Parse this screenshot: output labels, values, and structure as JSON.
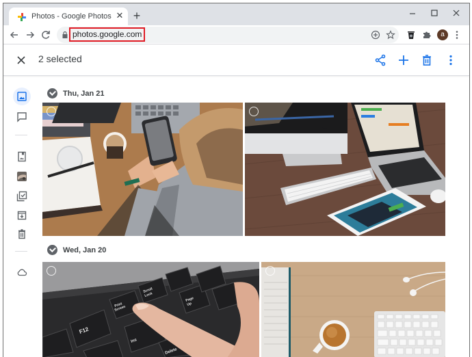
{
  "browser": {
    "tab": {
      "title": "Photos - Google Photos",
      "close_glyph": "✕",
      "favicon": "google-photos-pinwheel-icon"
    },
    "new_tab_glyph": "+",
    "window_controls": {
      "minimize": "–",
      "maximize": "☐",
      "close": "✕"
    },
    "nav": {
      "back": "←",
      "forward": "→",
      "reload": "C"
    },
    "address_bar": {
      "url": "photos.google.com",
      "highlighted": true,
      "highlight_color": "#e01b24"
    },
    "omnibox_icons": [
      "install-app-icon",
      "bookmark-star-icon"
    ],
    "toolbar_icons": [
      "trash-extension-icon",
      "extensions-puzzle-icon"
    ],
    "profile_avatar": {
      "letter": "a",
      "color": "#5d3a27"
    }
  },
  "app": {
    "selection_bar": {
      "close_glyph": "✕",
      "selected_text": "2 selected",
      "actions": [
        "share-icon",
        "add-icon",
        "delete-icon",
        "more-options-icon"
      ],
      "accent_color": "#1a73e8"
    },
    "sidebar": {
      "items": [
        {
          "name": "photos",
          "icon": "photo-icon",
          "active": true
        },
        {
          "name": "sharing",
          "icon": "chat-bubble-icon",
          "active": false
        },
        {
          "name": "albums",
          "icon": "album-icon",
          "active": false
        },
        {
          "name": "utilities-thumbnail",
          "icon": "thumbnail-icon",
          "active": false
        },
        {
          "name": "utilities",
          "icon": "collection-check-icon",
          "active": false
        },
        {
          "name": "archive",
          "icon": "archive-icon",
          "active": false
        },
        {
          "name": "trash",
          "icon": "trash-icon",
          "active": false
        },
        {
          "name": "storage",
          "icon": "cloud-icon",
          "active": false
        }
      ]
    },
    "groups": [
      {
        "date": "Thu, Jan 21",
        "photos": [
          {
            "description": "Person using smartphone at wooden desk with coffee cup, notebook and laptop"
          },
          {
            "description": "iMac, MacBook, wireless keyboard, iPad and mouse on dark wooden desk"
          }
        ]
      },
      {
        "date": "Wed, Jan 20",
        "photos": [
          {
            "description": "Finger pressing Print Screen key on black keyboard",
            "key_labels": [
              "F12",
              "Print Screen",
              "Scroll Lock",
              "Page Up",
              "Insert",
              "Delete"
            ]
          },
          {
            "description": "Notebook, coffee cup, earbuds and white keyboard on light wooden desk"
          }
        ]
      }
    ]
  }
}
